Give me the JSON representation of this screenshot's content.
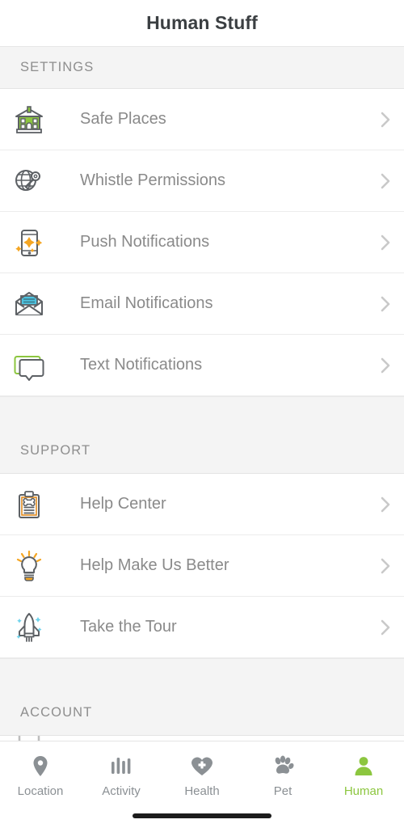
{
  "header": {
    "title": "Human Stuff"
  },
  "sections": [
    {
      "id": "settings",
      "label": "SETTINGS"
    },
    {
      "id": "support",
      "label": "SUPPORT"
    },
    {
      "id": "account",
      "label": "ACCOUNT"
    }
  ],
  "settings_rows": [
    {
      "label": "Safe Places",
      "icon": "safe-places-building-icon"
    },
    {
      "label": "Whistle Permissions",
      "icon": "globe-key-icon"
    },
    {
      "label": "Push Notifications",
      "icon": "phone-sparkle-icon"
    },
    {
      "label": "Email Notifications",
      "icon": "envelope-icon"
    },
    {
      "label": "Text Notifications",
      "icon": "speech-bubble-icon"
    }
  ],
  "support_rows": [
    {
      "label": "Help Center",
      "icon": "clipboard-bone-icon"
    },
    {
      "label": "Help Make Us Better",
      "icon": "lightbulb-icon"
    },
    {
      "label": "Take the Tour",
      "icon": "rocket-icon"
    }
  ],
  "tabs": [
    {
      "label": "Location",
      "icon": "map-pin-icon",
      "active": false
    },
    {
      "label": "Activity",
      "icon": "bar-chart-icon",
      "active": false
    },
    {
      "label": "Health",
      "icon": "heart-plus-icon",
      "active": false
    },
    {
      "label": "Pet",
      "icon": "paw-icon",
      "active": false
    },
    {
      "label": "Human",
      "icon": "person-icon",
      "active": true
    }
  ],
  "colors": {
    "accent_green": "#8CC63F",
    "icon_gray": "#5d6165",
    "orange": "#F5A623",
    "cyan": "#4EC3E0",
    "label_gray": "#8a8a8a",
    "band_gray": "#f4f4f4"
  },
  "chevron_glyph": "chevron-right-icon"
}
